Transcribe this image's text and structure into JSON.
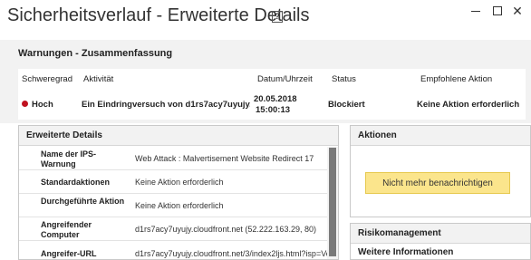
{
  "window": {
    "title": "Sicherheitsverlauf - Erweiterte Details",
    "help_glyph": "?",
    "close_glyph": "✕"
  },
  "summary": {
    "heading": "Warnungen - Zusammenfassung",
    "columns": {
      "severity": "Schweregrad",
      "activity": "Aktivität",
      "datetime": "Datum/Uhrzeit",
      "status": "Status",
      "recommended": "Empfohlene Aktion"
    },
    "row": {
      "severity": "Hoch",
      "severity_color": "#c0111f",
      "activity": "Ein Eindringversuch von d1rs7acy7uyujy....",
      "date": "20.05.2018",
      "time": "15:00:13",
      "status": "Blockiert",
      "recommended": "Keine Aktion erforderlich"
    }
  },
  "details": {
    "heading": "Erweiterte Details",
    "rows": [
      {
        "label": "Name der IPS-Warnung",
        "value": "Web Attack : Malvertisement Website Redirect 17"
      },
      {
        "label": "Standardaktionen",
        "value": "Keine Aktion erforderlich"
      },
      {
        "label": "Durchgeführte Aktion",
        "value": "Keine Aktion erforderlich"
      },
      {
        "label": "Angreifender Computer",
        "value": "d1rs7acy7uyujy.cloudfront.net (52.222.163.29, 80)"
      },
      {
        "label": "Angreifer-URL",
        "value": "d1rs7acy7uyujy.cloudfront.net/3/index2ljs.html?isp=Ve"
      }
    ]
  },
  "actions": {
    "heading": "Aktionen",
    "notify_button": "Nicht mehr benachrichtigen",
    "button_color": "#fbe58c"
  },
  "risk": {
    "heading": "Risikomanagement",
    "subheading": "Weitere Informationen"
  }
}
